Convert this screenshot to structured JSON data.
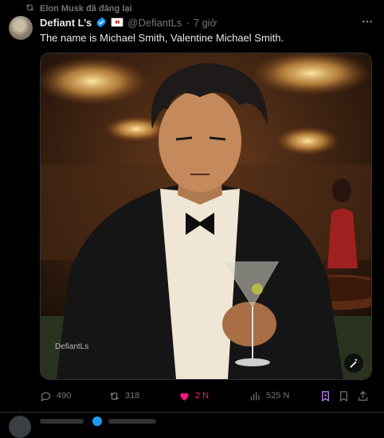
{
  "repost": {
    "icon": "repost-icon",
    "label": "Elon Musk đã đăng lại"
  },
  "author": {
    "display_name": "Defiant L’s",
    "handle": "@DefiantLs",
    "separator": "·",
    "time": "7 giờ",
    "verified_icon": "verified-badge-icon",
    "affiliate_icon": "affiliate-badge-icon",
    "verified_color": "#1d9bf0"
  },
  "tweet": {
    "text": "The name is Michael Smith, Valentine Michael Smith."
  },
  "media": {
    "watermark": "DefiantLs",
    "edit_icon": "sparkle-edit-icon"
  },
  "actions": {
    "reply": {
      "icon": "reply-icon",
      "count": "490"
    },
    "repost": {
      "icon": "repost-icon",
      "count": "318"
    },
    "like": {
      "icon": "heart-icon",
      "count": "2 N",
      "liked": true,
      "color": "#f91880"
    },
    "views": {
      "icon": "views-chart-icon",
      "count": "525 N"
    },
    "grok": {
      "icon": "grok-icon"
    },
    "bookmark": {
      "icon": "bookmark-icon"
    },
    "share": {
      "icon": "share-icon"
    }
  },
  "colors": {
    "background": "#000000",
    "text": "#e7e9ea",
    "muted": "#71767b",
    "accent": "#1d9bf0"
  }
}
